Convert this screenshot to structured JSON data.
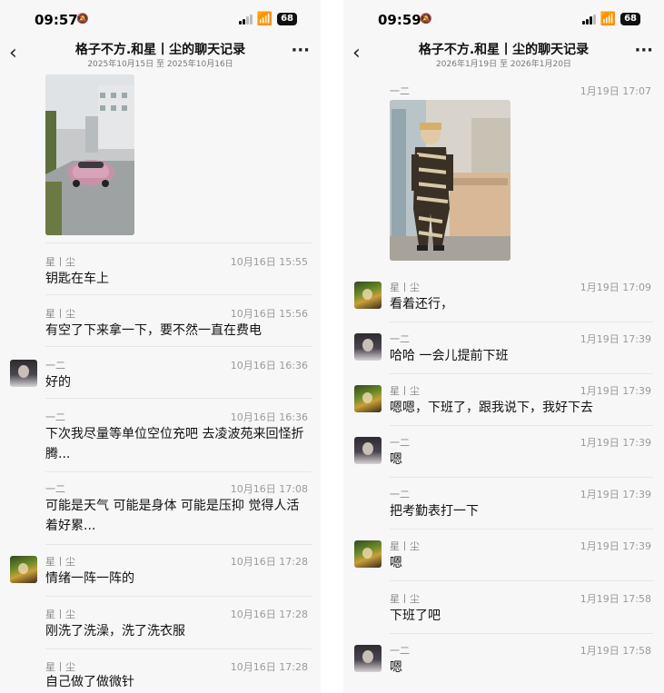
{
  "left": {
    "status": {
      "time": "09:57",
      "battery": "68"
    },
    "nav": {
      "title": "格子不方.和星丨尘的聊天记录",
      "subtitle": "2025年10月15日 至 2025年10月16日"
    },
    "messages": [
      {
        "sender": "星丨尘",
        "time": "10月16日 15:55",
        "text": "钥匙在车上"
      },
      {
        "sender": "星丨尘",
        "time": "10月16日 15:56",
        "text": "有空了下来拿一下，要不然一直在费电"
      },
      {
        "sender": "一二",
        "time": "10月16日 16:36",
        "text": "好的"
      },
      {
        "sender": "一二",
        "time": "10月16日 16:36",
        "text": "下次我尽量等单位空位充吧 去凌波苑来回怪折腾..."
      },
      {
        "sender": "一二",
        "time": "10月16日 17:08",
        "text": "可能是天气 可能是身体 可能是压抑 觉得人活着好累..."
      },
      {
        "sender": "星丨尘",
        "time": "10月16日 17:28",
        "text": "情绪一阵一阵的"
      },
      {
        "sender": "星丨尘",
        "time": "10月16日 17:28",
        "text": "刚洗了洗澡，洗了洗衣服"
      },
      {
        "sender": "星丨尘",
        "time": "10月16日 17:28",
        "text": "自己做了做微针"
      }
    ]
  },
  "right": {
    "status": {
      "time": "09:59",
      "battery": "68"
    },
    "nav": {
      "title": "格子不方.和星丨尘的聊天记录",
      "subtitle": "2026年1月19日 至 2026年1月20日"
    },
    "messages": [
      {
        "sender": "一二",
        "time": "1月19日 17:07",
        "text": ""
      },
      {
        "sender": "星丨尘",
        "time": "1月19日 17:09",
        "text": "看着还行，"
      },
      {
        "sender": "一二",
        "time": "1月19日 17:39",
        "text": "哈哈 一会儿提前下班"
      },
      {
        "sender": "星丨尘",
        "time": "1月19日 17:39",
        "text": "嗯嗯，下班了，跟我说下，我好下去"
      },
      {
        "sender": "一二",
        "time": "1月19日 17:39",
        "text": "嗯"
      },
      {
        "sender": "一二",
        "time": "1月19日 17:39",
        "text": "把考勤表打一下"
      },
      {
        "sender": "星丨尘",
        "time": "1月19日 17:39",
        "text": "嗯"
      },
      {
        "sender": "星丨尘",
        "time": "1月19日 17:58",
        "text": "下班了吧"
      },
      {
        "sender": "一二",
        "time": "1月19日 17:58",
        "text": "嗯"
      }
    ]
  },
  "icons": {
    "back": "chevron-left-icon",
    "more": "more-dots-icon",
    "signal": "signal-icon",
    "wifi": "wifi-icon",
    "battery": "battery-icon",
    "silent": "bell-slash-icon"
  }
}
